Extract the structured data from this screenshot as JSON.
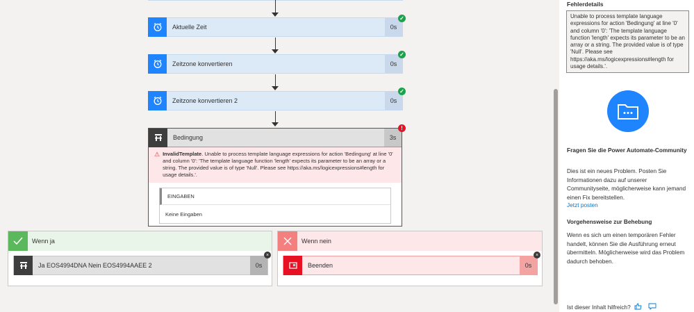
{
  "flow": {
    "steps": [
      {
        "title": "Aktuelle Zeit",
        "duration": "0s",
        "status": "success"
      },
      {
        "title": "Zeitzone konvertieren",
        "duration": "0s",
        "status": "success"
      },
      {
        "title": "Zeitzone konvertieren 2",
        "duration": "0s",
        "status": "success"
      }
    ],
    "condition": {
      "title": "Bedingung",
      "duration": "3s",
      "status": "failed",
      "error_code": "InvalidTemplate",
      "error_message": ". Unable to process template language expressions for action 'Bedingung' at line '0' and column '0': 'The template language function 'length' expects its parameter to be an array or a string. The provided value is of type 'Null'. Please see https://aka.ms/logicexpressions#length for usage details.'.",
      "inputs_label": "EINGABEN",
      "inputs_value": "Keine Eingaben"
    },
    "branch_yes": {
      "title": "Wenn ja",
      "action_title": "Ja EOS4994DNA Nein EOS4994AAEE 2",
      "action_duration": "0s"
    },
    "branch_no": {
      "title": "Wenn nein",
      "action_title": "Beenden",
      "action_duration": "0s"
    }
  },
  "panel": {
    "error_details_title": "Fehlerdetails",
    "error_details_text": "Unable to process template language expressions for action 'Bedingung' at line '0' and column '0': 'The template language function 'length' expects its parameter to be an array or a string. The provided value is of type 'Null'. Please see https://aka.ms/logicexpressions#length for usage details.'.",
    "community_title": "Fragen Sie die Power Automate-Community",
    "community_text": "Dies ist ein neues Problem. Posten Sie Informationen dazu auf unserer Communityseite, möglicherweise kann jemand einen Fix bereitstellen.",
    "post_link": "Jetzt posten",
    "remedy_title": "Vorgehensweise zur Behebung",
    "remedy_text": "Wenn es sich um einen temporären Fehler handelt, können Sie die Ausführung erneut übermitteln. Möglicherweise wird das Problem dadurch behoben.",
    "feedback_question": "Ist dieser Inhalt hilfreich?"
  },
  "colors": {
    "accent_blue": "#1f85ff",
    "success_green": "#1aa34a",
    "error_red": "#e81123",
    "yes_green": "#5cb85c",
    "no_red": "#f47f7f"
  }
}
